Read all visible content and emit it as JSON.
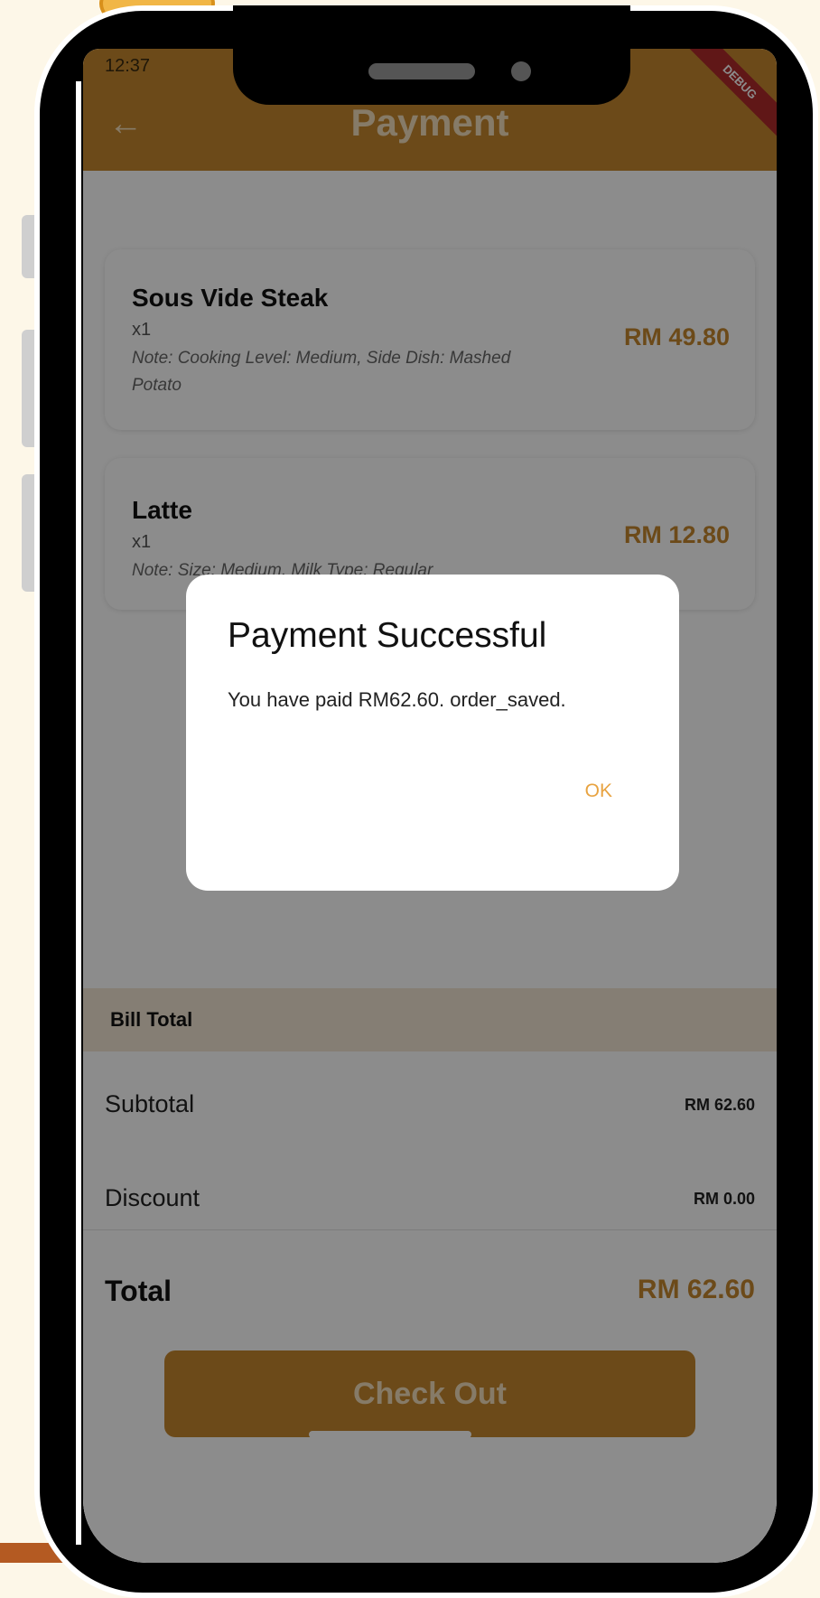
{
  "status_bar": {
    "time": "12:37"
  },
  "appbar": {
    "back_icon": "arrow-left-icon",
    "title": "Payment",
    "debug_banner": "DEBUG"
  },
  "order_items": [
    {
      "name": "Sous Vide Steak",
      "qty": "x1",
      "note": "Note: Cooking Level: Medium, Side Dish: Mashed Potato",
      "price": "RM 49.80"
    },
    {
      "name": "Latte",
      "qty": "x1",
      "note": "Note: Size: Medium, Milk Type: Regular",
      "price": "RM 12.80"
    }
  ],
  "bill": {
    "header": "Bill Total",
    "subtotal_label": "Subtotal",
    "subtotal_value": "RM 62.60",
    "discount_label": "Discount",
    "discount_value": "RM 0.00",
    "total_label": "Total",
    "total_value": "RM 62.60"
  },
  "checkout_button": "Check Out",
  "dialog": {
    "title": "Payment Successful",
    "message": "You have paid RM62.60. order_saved.",
    "ok_label": "OK"
  },
  "colors": {
    "accent": "#c5872f",
    "background": "#fdf7e8"
  }
}
